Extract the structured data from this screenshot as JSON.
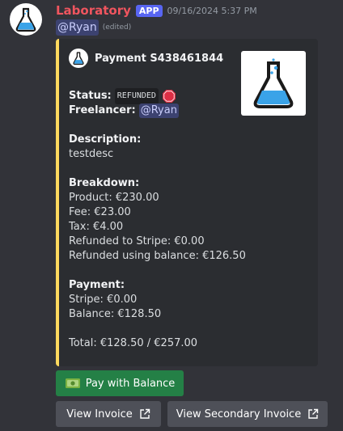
{
  "message": {
    "author": "Laboratory",
    "app_tag": "APP",
    "timestamp": "09/16/2024 5:37 PM",
    "mention": "@Ryan",
    "edited": "(edited)"
  },
  "embed": {
    "accent_color": "#ffd95e",
    "author_name": "Payment S438461844",
    "status_label": "Status:",
    "status_value": "REFUNDED",
    "freelancer_label": "Freelancer:",
    "freelancer_value": "@Ryan",
    "description_label": "Description:",
    "description_value": "testdesc",
    "breakdown_label": "Breakdown:",
    "product": "Product: €230.00",
    "fee": "Fee: €23.00",
    "tax": "Tax: €4.00",
    "refunded_stripe": "Refunded to Stripe: €0.00",
    "refunded_balance": "Refunded using balance: €126.50",
    "payment_label": "Payment:",
    "stripe": "Stripe: €0.00",
    "balance": "Balance: €128.50",
    "total": "Total: €128.50 / €257.00"
  },
  "buttons": {
    "pay_balance": "Pay with Balance",
    "view_invoice": "View Invoice",
    "view_secondary": "View Secondary Invoice"
  }
}
